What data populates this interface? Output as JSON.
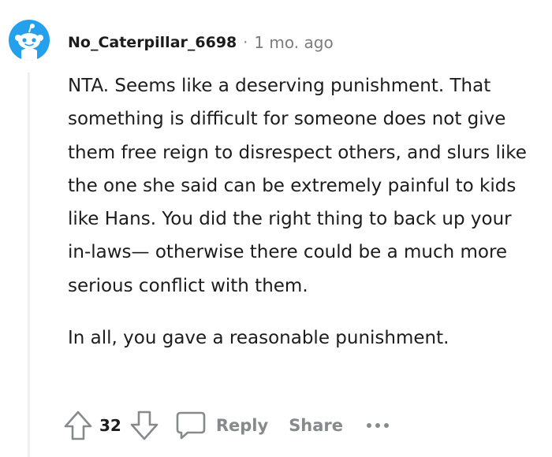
{
  "comment": {
    "username": "No_Caterpillar_6698",
    "separator": "·",
    "timestamp": "1 mo. ago",
    "paragraphs": [
      "NTA. Seems like a deserving punishment. That something is difficult for someone does not give them free reign to disrespect others, and slurs like the one she said can be extremely painful to kids like Hans. You did the right thing to back up your in-laws— otherwise there could be a much more serious conflict with them.",
      "In all, you gave a reasonable punishment."
    ]
  },
  "actions": {
    "vote_count": "32",
    "reply_label": "Reply",
    "share_label": "Share"
  },
  "icons": {
    "avatar": "snoo-avatar-icon",
    "upvote": "upvote-arrow-icon",
    "downvote": "downvote-arrow-icon",
    "reply": "comment-bubble-icon",
    "more": "ellipsis-icon"
  },
  "colors": {
    "text": "#1c1c1c",
    "muted": "#7c7c7c",
    "action": "#878a8c",
    "avatar_blue": "#24a0ed",
    "thread_line": "#edeff1"
  }
}
